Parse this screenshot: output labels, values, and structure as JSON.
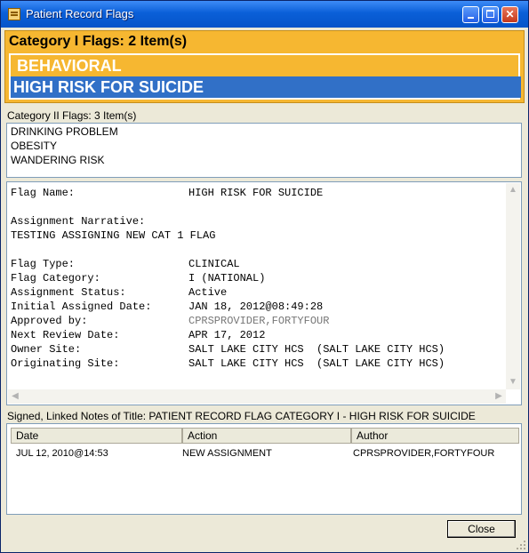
{
  "window": {
    "title": "Patient Record Flags",
    "colors": {
      "titlebar": "#0a5fd8",
      "category1_background": "#f6b731",
      "selection": "#3170c7"
    }
  },
  "category1": {
    "heading": "Category I Flags: 2 Item(s)",
    "items": [
      "BEHAVIORAL",
      "HIGH RISK FOR SUICIDE"
    ],
    "selected_index": 1
  },
  "category2": {
    "heading": "Category II Flags: 3 Item(s)",
    "items": [
      "DRINKING PROBLEM",
      "OBESITY",
      "WANDERING RISK"
    ]
  },
  "detail": {
    "flag_name_label": "Flag Name:",
    "flag_name": "HIGH RISK FOR SUICIDE",
    "narrative_label": "Assignment Narrative:",
    "narrative": "TESTING ASSIGNING NEW CAT 1 FLAG",
    "flag_type_label": "Flag Type:",
    "flag_type": "CLINICAL",
    "flag_category_label": "Flag Category:",
    "flag_category": "I (NATIONAL)",
    "status_label": "Assignment Status:",
    "status": "Active",
    "assigned_date_label": "Initial Assigned Date:",
    "assigned_date": "JAN 18, 2012@08:49:28",
    "approved_by_label": "Approved by:",
    "approved_by": "CPRSPROVIDER,FORTYFOUR",
    "review_date_label": "Next Review Date:",
    "review_date": "APR 17, 2012",
    "owner_site_label": "Owner Site:",
    "owner_site": "SALT LAKE CITY HCS  (SALT LAKE CITY HCS)",
    "orig_site_label": "Originating Site:",
    "orig_site": "SALT LAKE CITY HCS  (SALT LAKE CITY HCS)"
  },
  "notes": {
    "heading": "Signed, Linked Notes of Title: PATIENT RECORD FLAG CATEGORY I - HIGH RISK FOR SUICIDE",
    "columns": [
      "Date",
      "Action",
      "Author"
    ],
    "rows": [
      {
        "date": "JUL 12, 2010@14:53",
        "action": "NEW ASSIGNMENT",
        "author": "CPRSPROVIDER,FORTYFOUR"
      }
    ]
  },
  "buttons": {
    "close": "Close"
  },
  "icons": [
    "app-icon",
    "minimize-icon",
    "maximize-icon",
    "close-icon",
    "scroll-up-icon",
    "scroll-down-icon",
    "scroll-left-icon",
    "scroll-right-icon",
    "resize-grip-icon"
  ]
}
